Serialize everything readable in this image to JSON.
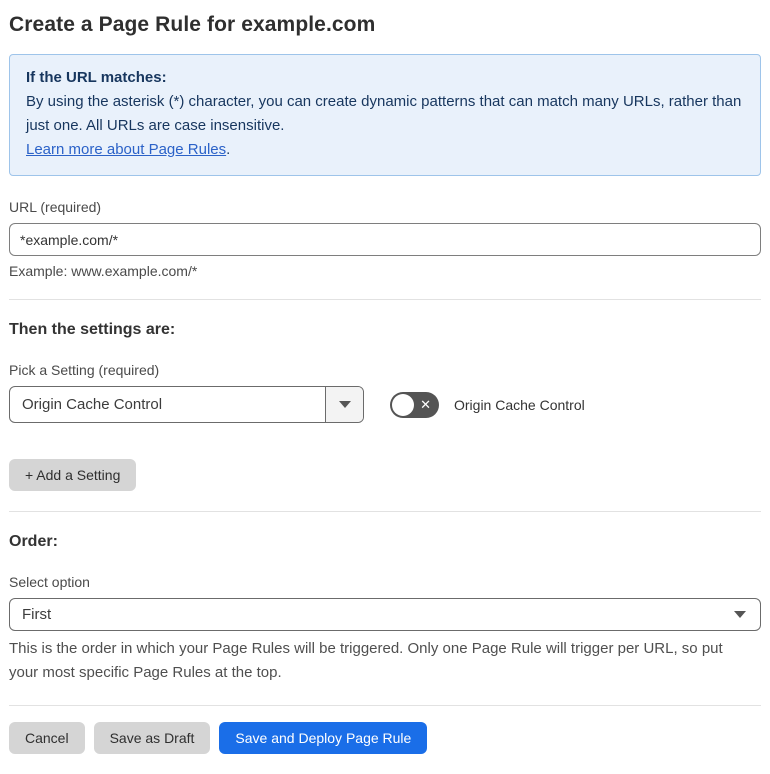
{
  "page": {
    "title": "Create a Page Rule for example.com"
  },
  "info_box": {
    "heading": "If the URL matches:",
    "body": "By using the asterisk (*) character, you can create dynamic patterns that can match many URLs, rather than just one. All URLs are case insensitive.",
    "link": "Learn more about Page Rules",
    "link_suffix": "."
  },
  "url_field": {
    "label": "URL (required)",
    "value": "*example.com/*",
    "example": "Example: www.example.com/*"
  },
  "settings": {
    "heading": "Then the settings are:",
    "picker_label": "Pick a Setting (required)",
    "selected_setting": "Origin Cache Control",
    "toggle_label": "Origin Cache Control",
    "toggle_state": "off",
    "add_setting_button": "+ Add a Setting"
  },
  "order": {
    "heading": "Order:",
    "select_label": "Select option",
    "selected_option": "First",
    "help_text": "This is the order in which your Page Rules will be triggered. Only one Page Rule will trigger per URL, so put your most specific Page Rules at the top."
  },
  "actions": {
    "cancel": "Cancel",
    "save_draft": "Save as Draft",
    "save_deploy": "Save and Deploy Page Rule"
  },
  "colors": {
    "accent_blue": "#1a6ee8",
    "info_background": "#e9f1fb",
    "info_border": "#9ec4ea",
    "info_text": "#17365e",
    "link_blue": "#2b62c8",
    "toggle_off_gray": "#545454"
  }
}
